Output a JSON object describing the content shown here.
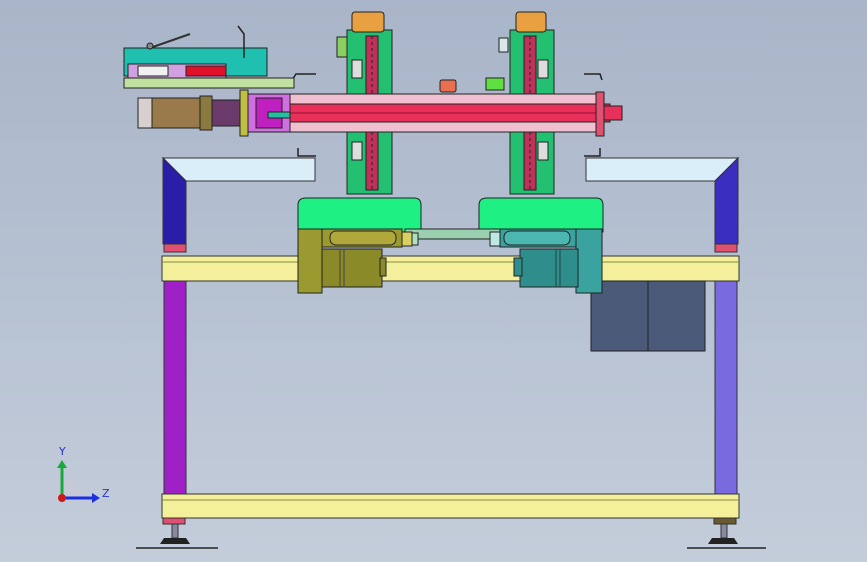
{
  "viewport": {
    "background_top": "#a9b5c8",
    "background_bottom": "#c4cdda"
  },
  "triad": {
    "y_label": "Y",
    "z_label": "Z",
    "y_color": "#19a83a",
    "z_color": "#1b2ee0",
    "x_color": "#d01818"
  },
  "model": {
    "frame_color": "#f3ef9a",
    "post_left_color": "#a020c8",
    "post_right_color": "#7a6ae0",
    "shaft_color": "#e8305a",
    "housing_color": "#22c070",
    "motor_color": "#9a9a30",
    "motor2_color": "#3aa3a0",
    "control_box_color": "#4a5a78"
  }
}
